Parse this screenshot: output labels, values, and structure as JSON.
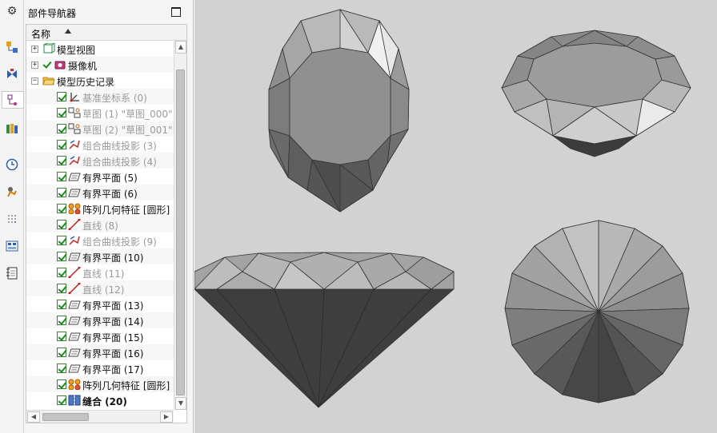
{
  "navigator": {
    "title": "部件导航器",
    "column_header": "名称"
  },
  "left_toolbar": {
    "items": [
      {
        "icon": "gear-icon"
      },
      {
        "icon": "assembly-navigator-icon"
      },
      {
        "icon": "constraint-navigator-icon"
      },
      {
        "icon": "part-navigator-icon"
      },
      {
        "icon": "reuse-library-icon"
      },
      {
        "icon": "history-icon"
      },
      {
        "icon": "process-studio-icon"
      },
      {
        "icon": "manufacturing-wizard-icon"
      },
      {
        "icon": "roles-icon"
      },
      {
        "icon": "system-materials-icon"
      }
    ]
  },
  "tree": {
    "items": [
      {
        "label": "模型视图",
        "icon": "model-views-icon",
        "expander": "+",
        "checked": false,
        "dim": false,
        "bold": false
      },
      {
        "label": "摄像机",
        "icon": "camera-icon",
        "expander": "+",
        "checked": true,
        "dim": false,
        "bold": false
      },
      {
        "label": "模型历史记录",
        "icon": "folder-open-icon",
        "expander": "−",
        "checked": false,
        "dim": false,
        "bold": false
      },
      {
        "label": "基准坐标系 (0)",
        "icon": "datum-csys-icon",
        "checked": true,
        "dim": true,
        "bold": false
      },
      {
        "label": "草图 (1) \"草图_000\"",
        "icon": "sketch-icon",
        "checked": true,
        "dim": true,
        "bold": false
      },
      {
        "label": "草图 (2) \"草图_001\"",
        "icon": "sketch-icon",
        "checked": true,
        "dim": true,
        "bold": false
      },
      {
        "label": "组合曲线投影 (3)",
        "icon": "combined-projection-icon",
        "checked": true,
        "dim": true,
        "bold": false
      },
      {
        "label": "组合曲线投影 (4)",
        "icon": "combined-projection-icon",
        "checked": true,
        "dim": true,
        "bold": false
      },
      {
        "label": "有界平面 (5)",
        "icon": "bounded-plane-icon",
        "checked": true,
        "dim": false,
        "bold": false
      },
      {
        "label": "有界平面 (6)",
        "icon": "bounded-plane-icon",
        "checked": true,
        "dim": false,
        "bold": false
      },
      {
        "label": "阵列几何特征 [圆形]",
        "icon": "pattern-geometry-icon",
        "checked": true,
        "dim": false,
        "bold": false
      },
      {
        "label": "直线 (8)",
        "icon": "line-icon",
        "checked": true,
        "dim": true,
        "bold": false
      },
      {
        "label": "组合曲线投影 (9)",
        "icon": "combined-projection-icon",
        "checked": true,
        "dim": true,
        "bold": false
      },
      {
        "label": "有界平面 (10)",
        "icon": "bounded-plane-icon",
        "checked": true,
        "dim": false,
        "bold": false
      },
      {
        "label": "直线 (11)",
        "icon": "line-icon",
        "checked": true,
        "dim": true,
        "bold": false
      },
      {
        "label": "直线 (12)",
        "icon": "line-icon",
        "checked": true,
        "dim": true,
        "bold": false
      },
      {
        "label": "有界平面 (13)",
        "icon": "bounded-plane-icon",
        "checked": true,
        "dim": false,
        "bold": false
      },
      {
        "label": "有界平面 (14)",
        "icon": "bounded-plane-icon",
        "checked": true,
        "dim": false,
        "bold": false
      },
      {
        "label": "有界平面 (15)",
        "icon": "bounded-plane-icon",
        "checked": true,
        "dim": false,
        "bold": false
      },
      {
        "label": "有界平面 (16)",
        "icon": "bounded-plane-icon",
        "checked": true,
        "dim": false,
        "bold": false
      },
      {
        "label": "有界平面 (17)",
        "icon": "bounded-plane-icon",
        "checked": true,
        "dim": false,
        "bold": false
      },
      {
        "label": "阵列几何特征 [圆形]",
        "icon": "pattern-geometry-icon",
        "checked": true,
        "dim": false,
        "bold": false
      },
      {
        "label": "缝合 (20)",
        "icon": "sew-icon",
        "checked": true,
        "dim": false,
        "bold": true
      }
    ]
  },
  "viewport": {
    "views": [
      {
        "name": "top-view"
      },
      {
        "name": "perspective-view"
      },
      {
        "name": "side-view"
      },
      {
        "name": "bottom-view"
      }
    ]
  }
}
